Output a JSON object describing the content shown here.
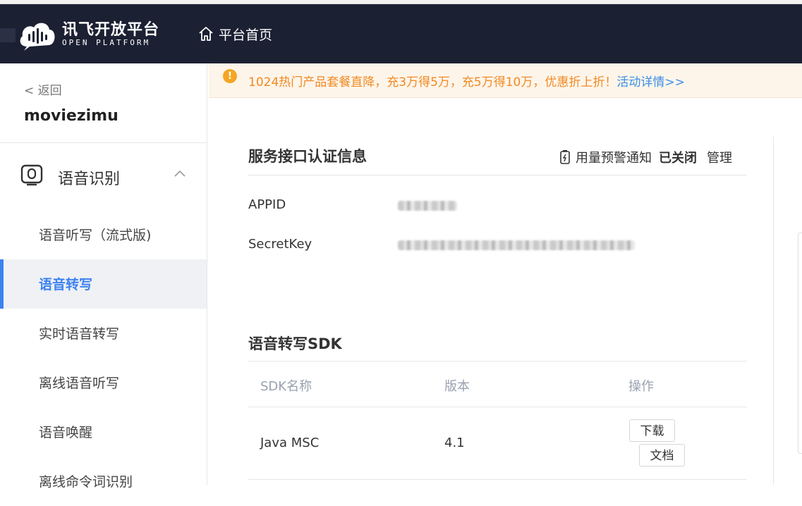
{
  "header": {
    "logo_title": "讯飞开放平台",
    "logo_subtitle": "OPEN PLATFORM",
    "home_label": "平台首页"
  },
  "sidebar": {
    "back_label": "< 返回",
    "app_name": "moviezimu",
    "group_label": "语音识别",
    "items": [
      {
        "label": "语音听写（流式版)"
      },
      {
        "label": "语音转写",
        "active": true
      },
      {
        "label": "实时语音转写"
      },
      {
        "label": "离线语音听写"
      },
      {
        "label": "语音唤醒"
      },
      {
        "label": "离线命令词识别"
      }
    ]
  },
  "notice": {
    "text": "1024热门产品套餐直降，充3万得5万，充5万得10万，优惠折上折！",
    "link": "活动详情>>"
  },
  "auth": {
    "title": "服务接口认证信息",
    "alert_label": "用量预警通知",
    "alert_status": "已关闭",
    "manage_label": "管理",
    "fields": [
      {
        "label": "APPID"
      },
      {
        "label": "SecretKey"
      }
    ]
  },
  "sdk": {
    "title": "语音转写SDK",
    "columns": [
      "SDK名称",
      "版本",
      "操作"
    ],
    "rows": [
      {
        "name": "Java MSC",
        "version": "4.1",
        "download_label": "下载",
        "doc_label": "文档"
      }
    ]
  },
  "colors": {
    "header_bg": "#1c2033",
    "accent": "#3b82f0",
    "notice_text": "#f08a24"
  }
}
